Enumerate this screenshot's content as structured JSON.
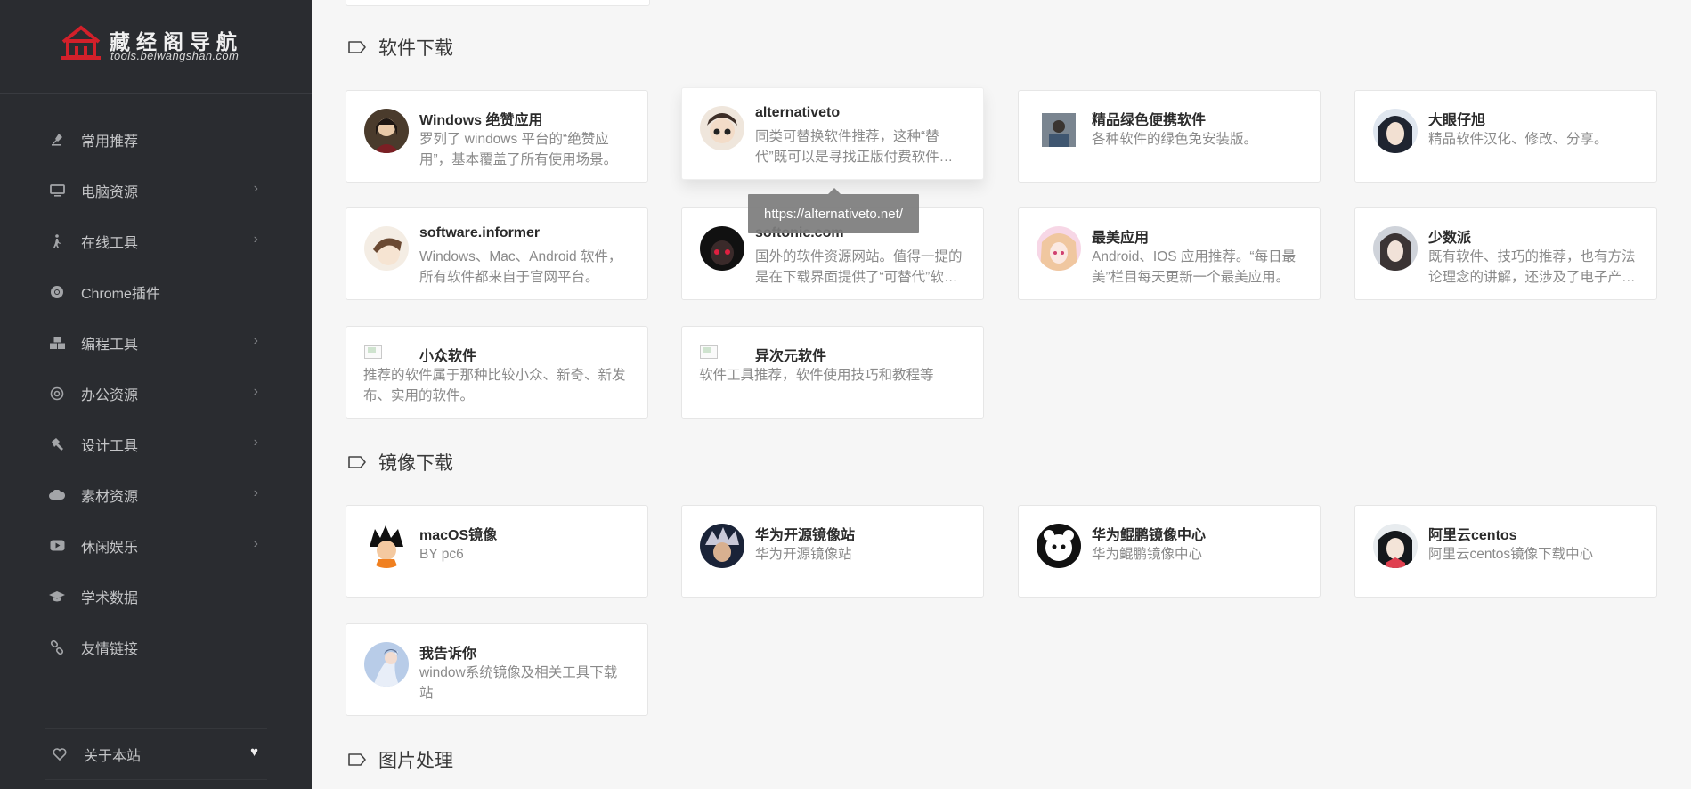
{
  "brand": {
    "title": "藏经阁导航",
    "subtitle": "tools.beiwangshan.com"
  },
  "nav": [
    {
      "label": "常用推荐",
      "icon": "pin-icon",
      "has_children": false
    },
    {
      "label": "电脑资源",
      "icon": "monitor-icon",
      "has_children": true
    },
    {
      "label": "在线工具",
      "icon": "walk-icon",
      "has_children": true
    },
    {
      "label": "Chrome插件",
      "icon": "chrome-icon",
      "has_children": false
    },
    {
      "label": "编程工具",
      "icon": "cubes-icon",
      "has_children": true
    },
    {
      "label": "办公资源",
      "icon": "openai-icon",
      "has_children": true
    },
    {
      "label": "设计工具",
      "icon": "hammer-icon",
      "has_children": true
    },
    {
      "label": "素材资源",
      "icon": "cloud-icon",
      "has_children": true
    },
    {
      "label": "休闲娱乐",
      "icon": "youtube-icon",
      "has_children": true
    },
    {
      "label": "学术数据",
      "icon": "graduation-cap-icon",
      "has_children": false
    },
    {
      "label": "友情链接",
      "icon": "link-icon",
      "has_children": false
    }
  ],
  "about": {
    "label": "关于本站",
    "icon": "heart-outline-icon",
    "badge_icon": "heart-icon"
  },
  "sections": {
    "software": {
      "title": "软件下载",
      "cards": [
        {
          "title": "Windows 绝赞应用",
          "desc": "罗列了 windows 平台的“绝赞应用”，基本覆盖了所有使用场景。"
        },
        {
          "title": "alternativeto",
          "desc": "同类可替换软件推荐，这种“替代”既可以是寻找正版付费软件的免费替代品，也可以是跨平台的同类软件。"
        },
        {
          "title": "精品绿色便携软件",
          "desc": "各种软件的绿色免安装版。"
        },
        {
          "title": "大眼仔旭",
          "desc": "精品软件汉化、修改、分享。"
        },
        {
          "title": "software.informer",
          "desc": "Windows、Mac、Android 软件，所有软件都来自于官网平台。"
        },
        {
          "title": "softonic.com",
          "desc": "国外的软件资源网站。值得一提的是在下载界面提供了“可替代”软件推荐。"
        },
        {
          "title": "最美应用",
          "desc": "Android、IOS 应用推荐。“每日最美”栏目每天更新一个最美应用。"
        },
        {
          "title": "少数派",
          "desc": "既有软件、技巧的推荐，也有方法论理念的讲解，还涉及了电子产品和数码评测。"
        },
        {
          "title": "小众软件",
          "desc": "推荐的软件属于那种比较小众、新奇、新发布、实用的软件。"
        },
        {
          "title": "异次元软件",
          "desc": "软件工具推荐，软件使用技巧和教程等"
        }
      ],
      "tooltip": "https://alternativeto.net/"
    },
    "mirror": {
      "title": "镜像下载",
      "cards": [
        {
          "title": "macOS镜像",
          "desc": "BY pc6"
        },
        {
          "title": "华为开源镜像站",
          "desc": "华为开源镜像站"
        },
        {
          "title": "华为鲲鹏镜像中心",
          "desc": "华为鲲鹏镜像中心"
        },
        {
          "title": "阿里云centos",
          "desc": "阿里云centos镜像下载中心"
        },
        {
          "title": "我告诉你",
          "desc": "window系统镜像及相关工具下载站"
        }
      ]
    },
    "image": {
      "title": "图片处理"
    }
  }
}
